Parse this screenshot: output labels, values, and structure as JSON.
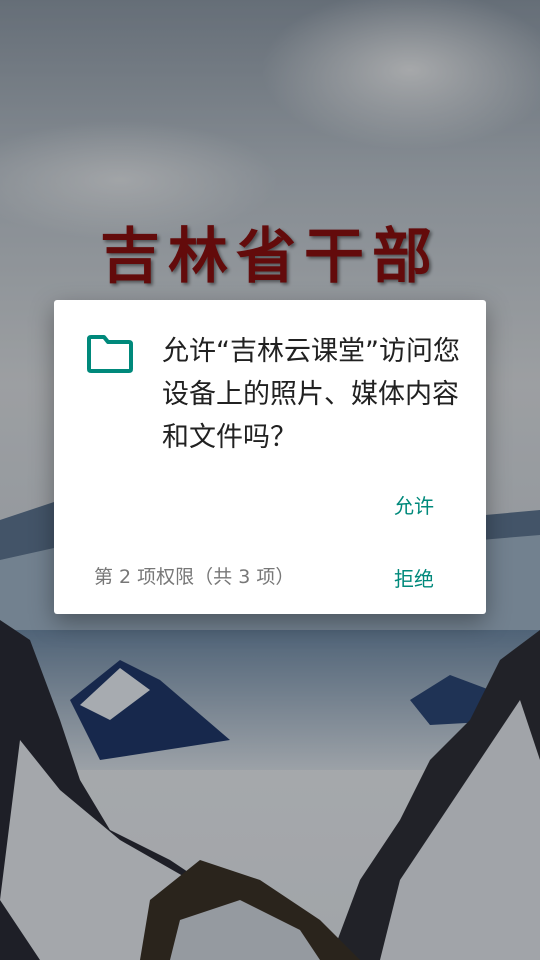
{
  "background": {
    "title": "吉林省干部"
  },
  "dialog": {
    "icon": "folder-icon",
    "message": "允许“吉林云课堂”访问您设备上的照片、媒体内容和文件吗？",
    "allow_label": "允许",
    "deny_label": "拒绝",
    "counter": "第 2 项权限（共 3 项）",
    "accent_color": "#00897b"
  }
}
